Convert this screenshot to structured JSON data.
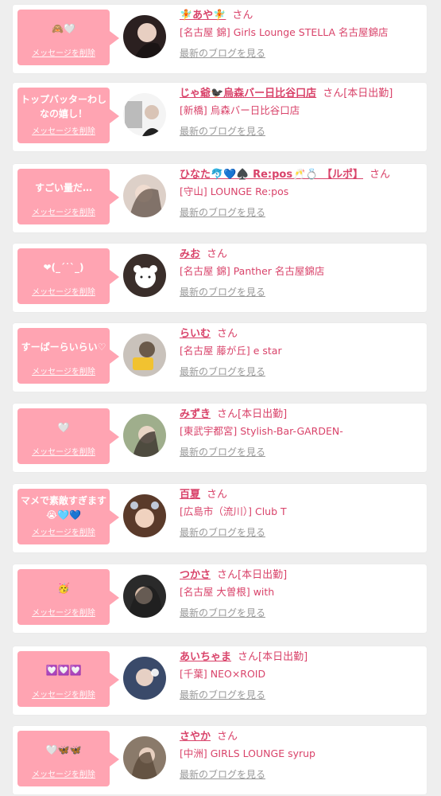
{
  "accent": "#d9436a",
  "bubble_color": "#ffa4b2",
  "delete_label": "メッセージを削除",
  "blog_label": "最新のブログを見る",
  "san_label": "さん",
  "items": [
    {
      "message": "🙈🤍",
      "name": "🧚あや🧚",
      "shift": "",
      "shop": "[名古屋 錦] Girls Lounge STELLA 名古屋錦店",
      "avatar_color": "#3a2a2a"
    },
    {
      "message": "トップバッターわしなの嬉し！",
      "name": "じゃ爺🐦‍⬛烏森バー日比谷口店",
      "shift": "[本日出勤]",
      "shop": "[新橋] 烏森バー日比谷口店",
      "avatar_color": "#9a9a9a"
    },
    {
      "message": "すごい量だ…",
      "name": "ひなた🐬💙♠️ Re:pos🥂💍 【ルポ】",
      "shift": "",
      "shop": "[守山] LOUNGE Re:pos",
      "avatar_color": "#c8b2a6"
    },
    {
      "message": "❤︎(_ˊ˙ˋ_)",
      "name": "みお",
      "shift": "",
      "shop": "[名古屋 錦] Panther 名古屋錦店",
      "avatar_color": "#4a3a33"
    },
    {
      "message": "すーぱーらいらい♡",
      "name": "らいむ",
      "shift": "",
      "shop": "[名古屋 藤が丘] e star",
      "avatar_color": "#c8a060"
    },
    {
      "message": "🤍",
      "name": "みずき",
      "shift": "[本日出勤]",
      "shop": "[東武宇都宮] Stylish-Bar-GARDEN-",
      "avatar_color": "#8f9f7a"
    },
    {
      "message": "マメで素敵すぎます😭🩵💙",
      "name": "百夏",
      "shift": "",
      "shop": "[広島市（流川）] Club T",
      "avatar_color": "#6b4a3a"
    },
    {
      "message": "🥳",
      "name": "つかさ",
      "shift": "[本日出勤]",
      "shop": "[名古屋 大曽根] with",
      "avatar_color": "#2e2e2e"
    },
    {
      "message": "💟💟💟",
      "name": "あいちゃま",
      "shift": "[本日出勤]",
      "shop": "[千葉] NEO×ROID",
      "avatar_color": "#4a5a7a"
    },
    {
      "message": "🤍🦋🦋",
      "name": "さやか",
      "shift": "",
      "shop": "[中洲] GIRLS LOUNGE syrup",
      "avatar_color": "#7a6a5a"
    }
  ]
}
